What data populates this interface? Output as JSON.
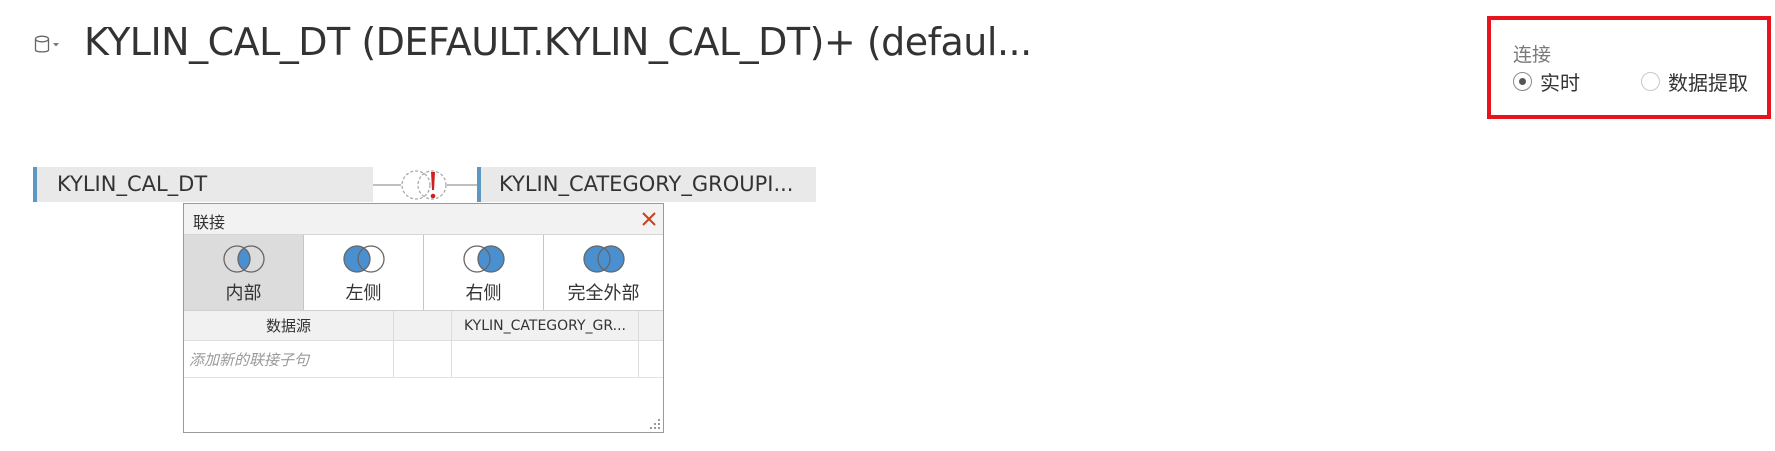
{
  "header": {
    "title": "KYLIN_CAL_DT (DEFAULT.KYLIN_CAL_DT)+ (defaul...",
    "datasource_icon": "database-icon",
    "dropdown_icon": "caret-down-icon"
  },
  "connection": {
    "label": "连接",
    "options": [
      {
        "label": "实时",
        "selected": true
      },
      {
        "label": "数据提取",
        "selected": false
      }
    ],
    "highlight_color": "#e8141d"
  },
  "canvas": {
    "left_table": "KYLIN_CAL_DT",
    "right_table": "KYLIN_CATEGORY_GROUPI...",
    "join_icon": "join-warning-icon"
  },
  "join_dialog": {
    "title": "联接",
    "close_icon": "close-icon",
    "join_types": [
      {
        "label": "内部",
        "icon": "inner-join-icon",
        "selected": true
      },
      {
        "label": "左侧",
        "icon": "left-join-icon",
        "selected": false
      },
      {
        "label": "右侧",
        "icon": "right-join-icon",
        "selected": false
      },
      {
        "label": "完全外部",
        "icon": "full-outer-join-icon",
        "selected": false
      }
    ],
    "columns": [
      "数据源",
      "",
      "KYLIN_CATEGORY_GR...",
      ""
    ],
    "add_clause_placeholder": "添加新的联接子句"
  },
  "colors": {
    "accent_blue": "#4a8fd0",
    "table_border": "#5d97c2",
    "warning_red": "#d01f1f"
  }
}
